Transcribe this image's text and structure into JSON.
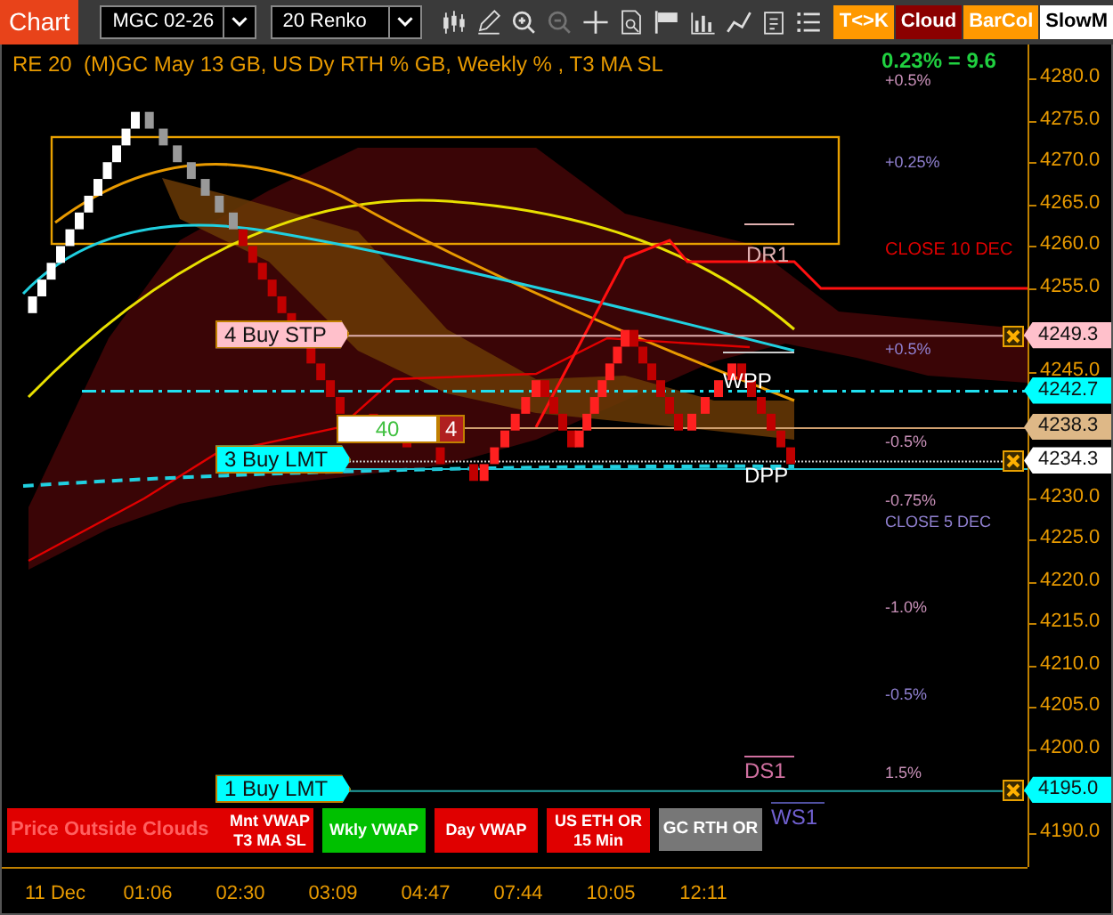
{
  "toolbar": {
    "tab": "Chart",
    "instrument": "MGC 02-26",
    "period": "20 Renko",
    "tools": [
      {
        "kind": "candles",
        "disabled": false
      },
      {
        "kind": "pencil",
        "disabled": false
      },
      {
        "kind": "zoomin",
        "disabled": false
      },
      {
        "kind": "zoomout",
        "disabled": true
      },
      {
        "kind": "crosshair",
        "disabled": false
      },
      {
        "kind": "docsearch",
        "disabled": false
      },
      {
        "kind": "flag",
        "disabled": false
      },
      {
        "kind": "bars",
        "disabled": false
      },
      {
        "kind": "nodes",
        "disabled": false
      },
      {
        "kind": "clipboard",
        "disabled": false
      },
      {
        "kind": "list",
        "disabled": false
      }
    ],
    "buttons": [
      {
        "label": "T<>K",
        "color": "#ff9900"
      },
      {
        "label": "Cloud",
        "color": "#8b0000"
      },
      {
        "label": "BarCol",
        "color": "#ff9900"
      },
      {
        "label": "SlowM",
        "color": "#ffffff"
      }
    ]
  },
  "chart": {
    "title": "RE 20  (M)GC May 13 GB, US Dy RTH % GB, Weekly % , T3 MA SL",
    "change": "0.23% = 9.6",
    "level_labels": [
      {
        "text": "+0.5%",
        "color": "#c890b8"
      },
      {
        "text": "+0.25%",
        "color": "#9080d0"
      },
      {
        "text": "CLOSE 10 DEC",
        "color": "#e00000"
      },
      {
        "text": "+0.5%",
        "color": "#9080d0"
      },
      {
        "text": "-0.5%",
        "color": "#c890b8"
      },
      {
        "text": "-0.75%",
        "color": "#c890b8"
      },
      {
        "text": "CLOSE 5 DEC",
        "color": "#9080d0"
      },
      {
        "text": "-1.0%",
        "color": "#c890b8"
      },
      {
        "text": "-0.5%",
        "color": "#9080d0"
      },
      {
        "text": "1.5%",
        "color": "#c890b8"
      }
    ],
    "pivots": [
      {
        "text": "DR1",
        "color": "#e0b0b0"
      },
      {
        "text": "WPP",
        "color": "#ffffff"
      },
      {
        "text": "DPP",
        "color": "#ffffff"
      },
      {
        "text": "DS1",
        "color": "#d070a0"
      },
      {
        "text": "WS1",
        "color": "#7060d0"
      }
    ],
    "orders": [
      {
        "label": "4 Buy STP",
        "kind": "stop",
        "price": "4249.3",
        "color": "#ffc0cb",
        "closable": true
      },
      {
        "label": "3 Buy LMT",
        "kind": "limit",
        "price": "4234.3",
        "color": "#ffffff",
        "closable": true
      },
      {
        "label": "1 Buy LMT",
        "kind": "limit",
        "price": "4195.0",
        "color": "#00ffff",
        "closable": true
      }
    ],
    "price_markers": [
      {
        "price": "4242.7",
        "color": "#00ffff"
      },
      {
        "price": "4238.3",
        "color": "#deb887"
      }
    ],
    "order_quantity": "40",
    "order_count": "4",
    "indicators": [
      {
        "lines": [
          "Mnt VWAP",
          "T3 MA SL"
        ],
        "note": "Price Outside Clouds",
        "color": "#e00000"
      },
      {
        "lines": [
          "Wkly VWAP"
        ],
        "color": "#00c000"
      },
      {
        "lines": [
          "Day VWAP"
        ],
        "color": "#e00000"
      },
      {
        "lines": [
          "US ETH OR 15 Min"
        ],
        "color": "#e00000"
      },
      {
        "lines": [
          "GC RTH OR"
        ],
        "color": "#777777"
      }
    ],
    "price_axis": [
      "4280.0",
      "4275.0",
      "4270.0",
      "4265.0",
      "4260.0",
      "4255.0",
      "4245.0",
      "4230.0",
      "4225.0",
      "4220.0",
      "4215.0",
      "4210.0",
      "4205.0",
      "4200.0",
      "4190.0"
    ],
    "time_axis": [
      "11 Dec",
      "01:06",
      "02:30",
      "03:09",
      "04:47",
      "07:44",
      "10:05",
      "12:11"
    ]
  }
}
